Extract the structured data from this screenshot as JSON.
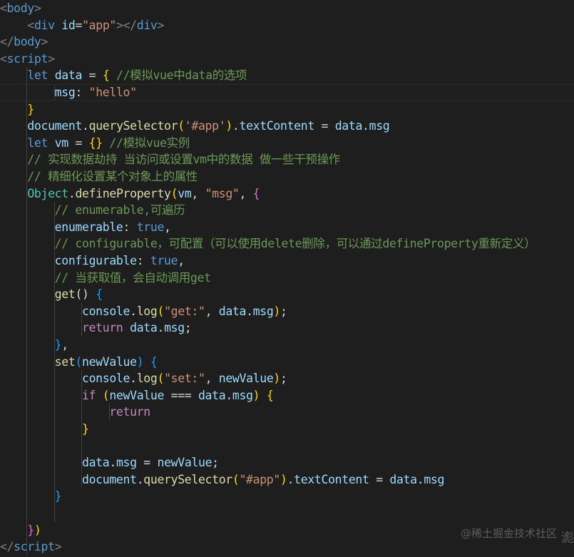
{
  "editor": {
    "theme_colors": {
      "background": "#1e1e1e",
      "tag": "#569cd6",
      "bracket": "#808080",
      "attribute": "#9cdcfe",
      "string": "#ce9178",
      "keyword": "#569cd6",
      "control_keyword": "#c586c0",
      "variable": "#9cdcfe",
      "function": "#dcdcaa",
      "class": "#4ec9b0",
      "comment": "#6a9955",
      "brace_level1": "#ffd700",
      "brace_level2": "#da70d6",
      "brace_level3": "#179fff",
      "default": "#d4d4d4",
      "indent_guide": "#404040"
    },
    "lines": [
      {
        "tokens": [
          {
            "t": "<",
            "c": "bracket"
          },
          {
            "t": "body",
            "c": "tag"
          },
          {
            "t": ">",
            "c": "bracket"
          }
        ]
      },
      {
        "tokens": [
          {
            "t": "    "
          },
          {
            "t": "<",
            "c": "bracket"
          },
          {
            "t": "div",
            "c": "tag"
          },
          {
            "t": " "
          },
          {
            "t": "id",
            "c": "attribute"
          },
          {
            "t": "="
          },
          {
            "t": "\"app\"",
            "c": "string"
          },
          {
            "t": "></",
            "c": "bracket"
          },
          {
            "t": "div",
            "c": "tag"
          },
          {
            "t": ">",
            "c": "bracket"
          }
        ]
      },
      {
        "tokens": [
          {
            "t": "</",
            "c": "bracket"
          },
          {
            "t": "body",
            "c": "tag"
          },
          {
            "t": ">",
            "c": "bracket"
          }
        ]
      },
      {
        "tokens": [
          {
            "t": "<",
            "c": "bracket"
          },
          {
            "t": "script",
            "c": "tag"
          },
          {
            "t": ">",
            "c": "bracket"
          }
        ]
      },
      {
        "tokens": [
          {
            "t": "    "
          },
          {
            "t": "let",
            "c": "keyword"
          },
          {
            "t": " "
          },
          {
            "t": "data",
            "c": "variable"
          },
          {
            "t": " = "
          },
          {
            "t": "{",
            "c": "brace_level1"
          },
          {
            "t": " "
          },
          {
            "t": "//模拟vue中data的选项",
            "c": "comment"
          }
        ]
      },
      {
        "tokens": [
          {
            "t": "        "
          },
          {
            "t": "msg",
            "c": "variable"
          },
          {
            "t": ": "
          },
          {
            "t": "\"hello\"",
            "c": "string"
          }
        ],
        "highlight": true
      },
      {
        "tokens": [
          {
            "t": "    "
          },
          {
            "t": "}",
            "c": "brace_level1"
          }
        ]
      },
      {
        "tokens": [
          {
            "t": "    "
          },
          {
            "t": "document",
            "c": "variable"
          },
          {
            "t": "."
          },
          {
            "t": "querySelector",
            "c": "function"
          },
          {
            "t": "(",
            "c": "brace_level1"
          },
          {
            "t": "'#app'",
            "c": "string"
          },
          {
            "t": ")",
            "c": "brace_level1"
          },
          {
            "t": "."
          },
          {
            "t": "textContent",
            "c": "variable"
          },
          {
            "t": " = "
          },
          {
            "t": "data",
            "c": "variable"
          },
          {
            "t": "."
          },
          {
            "t": "msg",
            "c": "variable"
          }
        ]
      },
      {
        "tokens": [
          {
            "t": "    "
          },
          {
            "t": "let",
            "c": "keyword"
          },
          {
            "t": " "
          },
          {
            "t": "vm",
            "c": "variable"
          },
          {
            "t": " = "
          },
          {
            "t": "{}",
            "c": "brace_level1"
          },
          {
            "t": " "
          },
          {
            "t": "//模拟vue实例",
            "c": "comment"
          }
        ]
      },
      {
        "tokens": [
          {
            "t": "    "
          },
          {
            "t": "// 实现数据劫持 当访问或设置vm中的数据 做一些干预操作",
            "c": "comment"
          }
        ]
      },
      {
        "tokens": [
          {
            "t": "    "
          },
          {
            "t": "// 精细化设置某个对象上的属性",
            "c": "comment"
          }
        ]
      },
      {
        "tokens": [
          {
            "t": "    "
          },
          {
            "t": "Object",
            "c": "class"
          },
          {
            "t": "."
          },
          {
            "t": "defineProperty",
            "c": "function"
          },
          {
            "t": "(",
            "c": "brace_level1"
          },
          {
            "t": "vm",
            "c": "variable"
          },
          {
            "t": ", "
          },
          {
            "t": "\"msg\"",
            "c": "string"
          },
          {
            "t": ", "
          },
          {
            "t": "{",
            "c": "brace_level2"
          }
        ]
      },
      {
        "tokens": [
          {
            "t": "        "
          },
          {
            "t": "// enumerable,可遍历",
            "c": "comment"
          }
        ]
      },
      {
        "tokens": [
          {
            "t": "        "
          },
          {
            "t": "enumerable",
            "c": "variable"
          },
          {
            "t": ": "
          },
          {
            "t": "true",
            "c": "keyword"
          },
          {
            "t": ","
          }
        ]
      },
      {
        "tokens": [
          {
            "t": "        "
          },
          {
            "t": "// configurable，可配置（可以使用delete删除，可以通过defineProperty重新定义）",
            "c": "comment"
          }
        ]
      },
      {
        "tokens": [
          {
            "t": "        "
          },
          {
            "t": "configurable",
            "c": "variable"
          },
          {
            "t": ": "
          },
          {
            "t": "true",
            "c": "keyword"
          },
          {
            "t": ","
          }
        ]
      },
      {
        "tokens": [
          {
            "t": "        "
          },
          {
            "t": "// 当获取值，会自动调用get",
            "c": "comment"
          }
        ]
      },
      {
        "tokens": [
          {
            "t": "        "
          },
          {
            "t": "get",
            "c": "function"
          },
          {
            "t": "() "
          },
          {
            "t": "{",
            "c": "brace_level3"
          }
        ]
      },
      {
        "tokens": [
          {
            "t": "            "
          },
          {
            "t": "console",
            "c": "variable"
          },
          {
            "t": "."
          },
          {
            "t": "log",
            "c": "function"
          },
          {
            "t": "(",
            "c": "brace_level1"
          },
          {
            "t": "\"get:\"",
            "c": "string"
          },
          {
            "t": ", "
          },
          {
            "t": "data",
            "c": "variable"
          },
          {
            "t": "."
          },
          {
            "t": "msg",
            "c": "variable"
          },
          {
            "t": ")",
            "c": "brace_level1"
          },
          {
            "t": ";"
          }
        ]
      },
      {
        "tokens": [
          {
            "t": "            "
          },
          {
            "t": "return",
            "c": "control_keyword"
          },
          {
            "t": " "
          },
          {
            "t": "data",
            "c": "variable"
          },
          {
            "t": "."
          },
          {
            "t": "msg",
            "c": "variable"
          },
          {
            "t": ";"
          }
        ]
      },
      {
        "tokens": [
          {
            "t": "        "
          },
          {
            "t": "}",
            "c": "brace_level3"
          },
          {
            "t": ","
          }
        ]
      },
      {
        "tokens": [
          {
            "t": "        "
          },
          {
            "t": "set",
            "c": "function"
          },
          {
            "t": "(",
            "c": "brace_level3"
          },
          {
            "t": "newValue",
            "c": "variable"
          },
          {
            "t": ") ",
            "c": "brace_level3"
          },
          {
            "t": "{",
            "c": "brace_level3"
          }
        ]
      },
      {
        "tokens": [
          {
            "t": "            "
          },
          {
            "t": "console",
            "c": "variable"
          },
          {
            "t": "."
          },
          {
            "t": "log",
            "c": "function"
          },
          {
            "t": "(",
            "c": "brace_level1"
          },
          {
            "t": "\"set:\"",
            "c": "string"
          },
          {
            "t": ", "
          },
          {
            "t": "newValue",
            "c": "variable"
          },
          {
            "t": ")",
            "c": "brace_level1"
          },
          {
            "t": ";"
          }
        ]
      },
      {
        "tokens": [
          {
            "t": "            "
          },
          {
            "t": "if",
            "c": "control_keyword"
          },
          {
            "t": " "
          },
          {
            "t": "(",
            "c": "brace_level1"
          },
          {
            "t": "newValue",
            "c": "variable"
          },
          {
            "t": " === "
          },
          {
            "t": "data",
            "c": "variable"
          },
          {
            "t": "."
          },
          {
            "t": "msg",
            "c": "variable"
          },
          {
            "t": ")",
            "c": "brace_level1"
          },
          {
            "t": " "
          },
          {
            "t": "{",
            "c": "brace_level1"
          }
        ]
      },
      {
        "tokens": [
          {
            "t": "                "
          },
          {
            "t": "return",
            "c": "control_keyword"
          }
        ]
      },
      {
        "tokens": [
          {
            "t": "            "
          },
          {
            "t": "}",
            "c": "brace_level1"
          }
        ]
      },
      {
        "tokens": []
      },
      {
        "tokens": [
          {
            "t": "            "
          },
          {
            "t": "data",
            "c": "variable"
          },
          {
            "t": "."
          },
          {
            "t": "msg",
            "c": "variable"
          },
          {
            "t": " = "
          },
          {
            "t": "newValue",
            "c": "variable"
          },
          {
            "t": ";"
          }
        ]
      },
      {
        "tokens": [
          {
            "t": "            "
          },
          {
            "t": "document",
            "c": "variable"
          },
          {
            "t": "."
          },
          {
            "t": "querySelector",
            "c": "function"
          },
          {
            "t": "(",
            "c": "brace_level1"
          },
          {
            "t": "\"#app\"",
            "c": "string"
          },
          {
            "t": ")",
            "c": "brace_level1"
          },
          {
            "t": "."
          },
          {
            "t": "textContent",
            "c": "variable"
          },
          {
            "t": " = "
          },
          {
            "t": "data",
            "c": "variable"
          },
          {
            "t": "."
          },
          {
            "t": "msg",
            "c": "variable"
          }
        ]
      },
      {
        "tokens": [
          {
            "t": "        "
          },
          {
            "t": "}",
            "c": "brace_level3"
          }
        ]
      },
      {
        "tokens": []
      },
      {
        "tokens": [
          {
            "t": "    "
          },
          {
            "t": "}",
            "c": "brace_level2"
          },
          {
            "t": ")",
            "c": "brace_level1"
          }
        ]
      },
      {
        "tokens": [
          {
            "t": "</",
            "c": "bracket"
          },
          {
            "t": "script",
            "c": "tag"
          },
          {
            "t": ">",
            "c": "bracket"
          }
        ]
      }
    ]
  },
  "watermark": {
    "text": "@稀土掘金技术社区",
    "corner_glyph": "滮"
  }
}
